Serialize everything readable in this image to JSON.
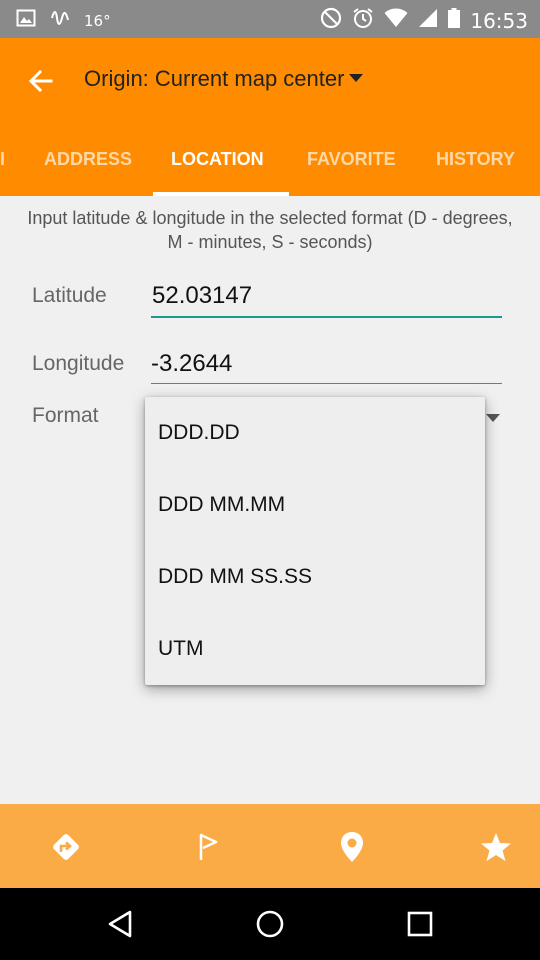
{
  "status_bar": {
    "temperature": "16°",
    "time": "16:53",
    "icons": [
      "image-icon",
      "activity-icon",
      "do-not-disturb-icon",
      "alarm-icon",
      "wifi-icon",
      "signal-icon",
      "battery-icon"
    ]
  },
  "toolbar": {
    "title": "Origin: Current map center",
    "back_icon": "arrow-back-icon"
  },
  "tabs": [
    {
      "label": "I",
      "active": false
    },
    {
      "label": "ADDRESS",
      "active": false
    },
    {
      "label": "LOCATION",
      "active": true
    },
    {
      "label": "FAVORITE",
      "active": false
    },
    {
      "label": "HISTORY",
      "active": false
    }
  ],
  "content": {
    "hint": "Input latitude & longitude in the selected format (D - degrees, M - minutes, S - seconds)",
    "latitude": {
      "label": "Latitude",
      "value": "52.03147"
    },
    "longitude": {
      "label": "Longitude",
      "value": "-3.2644"
    },
    "format": {
      "label": "Format"
    }
  },
  "format_menu": {
    "options": [
      "DDD.DD",
      "DDD MM.MM",
      "DDD MM SS.SS",
      "UTM"
    ]
  },
  "action_bar": {
    "icons": [
      "directions-icon",
      "flag-icon",
      "place-icon",
      "star-icon"
    ]
  },
  "colors": {
    "primary": "#ff8c00",
    "action_bar": "#fbab46",
    "focus_line": "#1e9888"
  }
}
